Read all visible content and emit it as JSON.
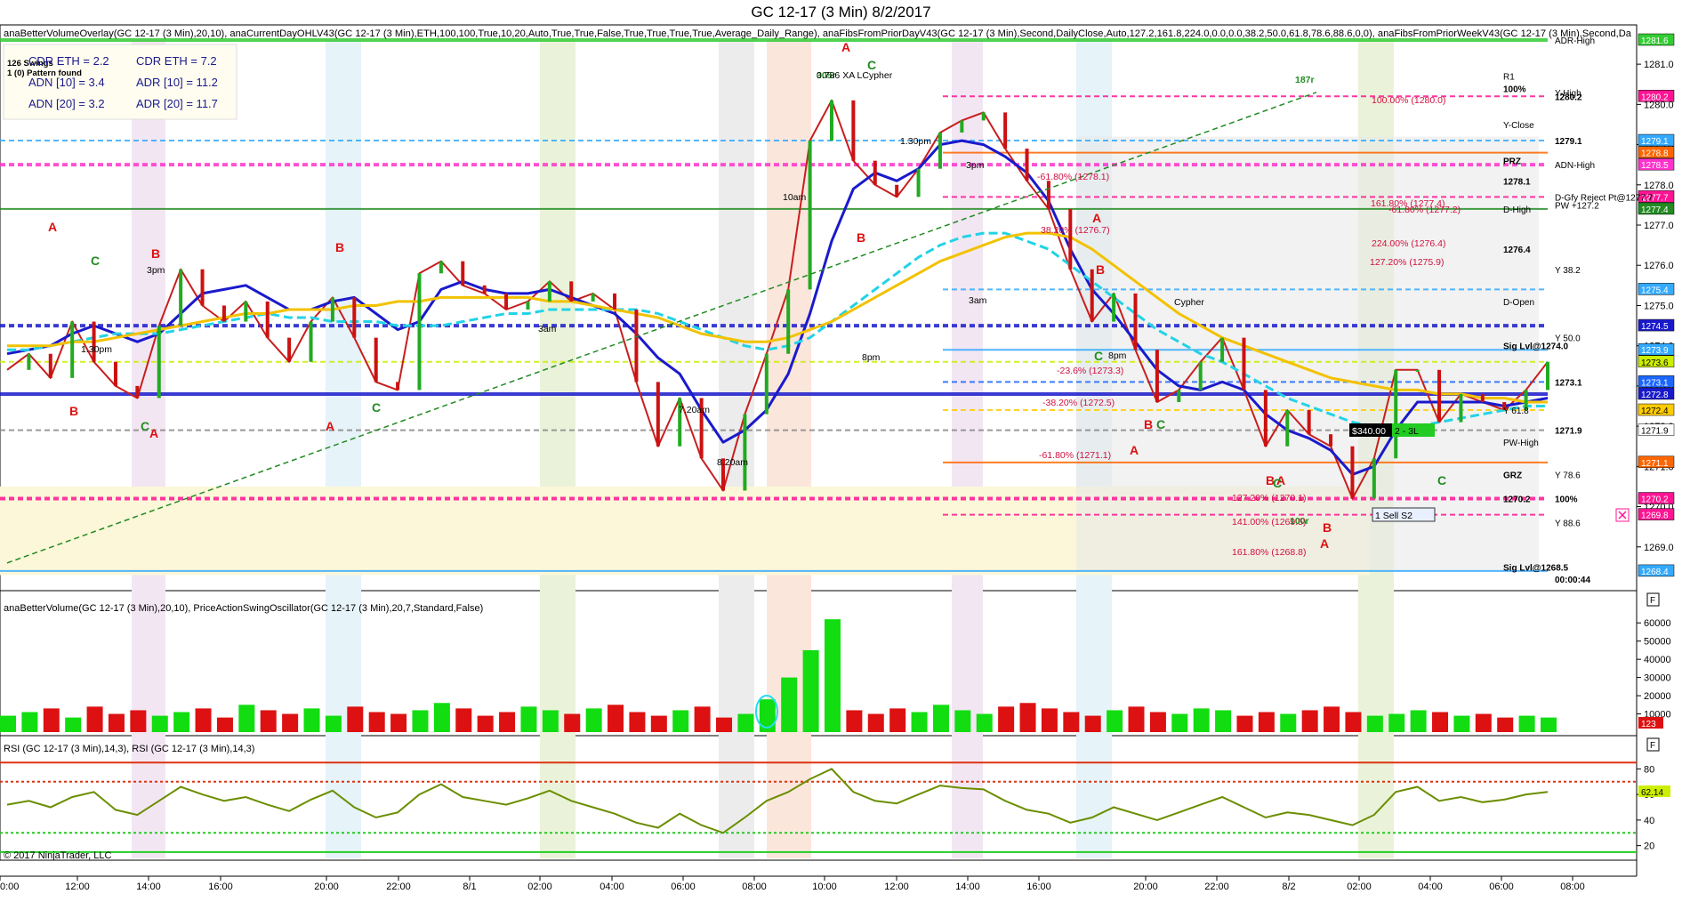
{
  "window": {
    "title": "GC 12-17 (3 Min)  8/2/2017"
  },
  "panels": {
    "price_header": "anaBetterVolumeOverlay(GC 12-17 (3 Min),20,10), anaCurrentDayOHLV43(GC 12-17 (3 Min),ETH,100,100,True,10,20,Auto,True,True,False,True,True,True,True,Average_Daily_Range), anaFibsFromPriorDayV43(GC 12-17 (3 Min),Second,DailyClose,Auto,127.2,161.8,224.0,0.0,0.0,38.2,50.0,61.8,78.6,88.6,0,0), anaFibsFromPriorWeekV43(GC 12-17 (3 Min),Second,Da",
    "volume_header": "anaBetterVolume(GC 12-17 (3 Min),20,10), PriceActionSwingOscillator(GC 12-17 (3 Min),20,7,Standard,False)",
    "rsi_header": "RSI (GC 12-17 (3 Min),14,3), RSI (GC 12-17 (3 Min),14,3)",
    "copyright": "© 2017 NinjaTrader, LLC"
  },
  "swings": {
    "count": "126 Swings",
    "pattern": "1 (0) Pattern found"
  },
  "stats_box": {
    "cdr_eth_1": "CDR ETH = 2.2",
    "cdr_eth_2": "CDR ETH = 7.2",
    "adn10_1": "ADN [10] = 3.4",
    "adr10_2": "ADR [10] = 11.2",
    "adn20_1": "ADN [20] = 3.2",
    "adr20_2": "ADR [20] = 11.7"
  },
  "axis_icons": {
    "f1": "F",
    "f2": "F"
  },
  "chart_data": [
    {
      "type": "line",
      "panel": "price",
      "x_ticks": [
        "0:00",
        "12:00",
        "14:00",
        "16:00",
        "20:00",
        "22:00",
        "8/1",
        "02:00",
        "04:00",
        "06:00",
        "08:00",
        "10:00",
        "12:00",
        "14:00",
        "16:00",
        "20:00",
        "22:00",
        "8/2",
        "02:00",
        "04:00",
        "06:00",
        "08:00"
      ],
      "y_ticks": [
        "1281.0",
        "1280.0",
        "1279.0",
        "1278.0",
        "1277.0",
        "1276.0",
        "1275.0",
        "1274.0",
        "1273.0",
        "1272.0",
        "1271.0",
        "1270.0",
        "1269.0"
      ],
      "ylim": [
        1268.0,
        1281.6
      ],
      "price_tags": [
        {
          "text": "1281.6",
          "color": "#33cc33",
          "y": 1281.6
        },
        {
          "text": "1280.2",
          "color": "#ff1493",
          "y": 1280.2
        },
        {
          "text": "1279.1",
          "color": "#33aaff",
          "y": 1279.1
        },
        {
          "text": "1278.8",
          "color": "#ff6600",
          "y": 1278.8
        },
        {
          "text": "1278.5",
          "color": "#ff33cc",
          "y": 1278.5
        },
        {
          "text": "1277.7",
          "color": "#ff1493",
          "y": 1277.7
        },
        {
          "text": "1277.4",
          "color": "#228b22",
          "y": 1277.4
        },
        {
          "text": "1275.4",
          "color": "#33aaff",
          "y": 1275.4
        },
        {
          "text": "1274.5",
          "color": "#1a1acc",
          "y": 1274.5
        },
        {
          "text": "1273.9",
          "color": "#33aaff",
          "y": 1273.9
        },
        {
          "text": "1273.6",
          "color": "#ccee00",
          "y": 1273.6
        },
        {
          "text": "1273.1",
          "color": "#1a66ff",
          "y": 1273.1
        },
        {
          "text": "1272.8",
          "color": "#1a1acc",
          "y": 1272.8
        },
        {
          "text": "1272.4",
          "color": "#ffcc00",
          "y": 1272.4
        },
        {
          "text": "1271.9",
          "color": "#ffffff",
          "y": 1271.9
        },
        {
          "text": "1271.1",
          "color": "#ff6600",
          "y": 1271.1
        },
        {
          "text": "1270.2",
          "color": "#ff1493",
          "y": 1270.2
        },
        {
          "text": "1269.8",
          "color": "#ff1493",
          "y": 1269.8
        },
        {
          "text": "1268.4",
          "color": "#33aaff",
          "y": 1268.4
        }
      ],
      "level_labels": [
        {
          "text": "ADR-High",
          "y": 1281.6
        },
        {
          "text": "R1",
          "y": 1280.7
        },
        {
          "text": "Y-High",
          "y": 1280.3
        },
        {
          "text": "100%",
          "y": 1280.4
        },
        {
          "text": "1280.2",
          "y": 1280.2
        },
        {
          "text": "Y-Close",
          "y": 1279.5
        },
        {
          "text": "1279.1",
          "y": 1279.1
        },
        {
          "text": "PRZ",
          "y": 1278.6
        },
        {
          "text": "ADN-High",
          "y": 1278.5
        },
        {
          "text": "1278.1",
          "y": 1278.1
        },
        {
          "text": "D-Gfy Reject Pt@1277.7",
          "y": 1277.7
        },
        {
          "text": "D-High",
          "y": 1277.4
        },
        {
          "text": "PW +127.2",
          "y": 1277.5
        },
        {
          "text": "1276.4",
          "y": 1276.4
        },
        {
          "text": "Y 38.2",
          "y": 1275.9
        },
        {
          "text": "D-Open",
          "y": 1275.1
        },
        {
          "text": "Y 50.0",
          "y": 1274.2
        },
        {
          "text": "Sig Lvl@1274.0",
          "y": 1274.0
        },
        {
          "text": "1273.1",
          "y": 1273.1
        },
        {
          "text": "Y 61.8",
          "y": 1272.4
        },
        {
          "text": "1271.9",
          "y": 1271.9
        },
        {
          "text": "PW-High",
          "y": 1271.6
        },
        {
          "text": "Y 78.6",
          "y": 1270.8
        },
        {
          "text": "GRZ",
          "y": 1270.8
        },
        {
          "text": "100%",
          "y": 1270.2
        },
        {
          "text": "1270.2",
          "y": 1270.2
        },
        {
          "text": "Y 88.6",
          "y": 1269.6
        },
        {
          "text": "Sig Lvl@1268.5",
          "y": 1268.5
        },
        {
          "text": "00:00:44",
          "y": 1268.2
        }
      ],
      "chart_annotations": [
        "305r",
        "187r",
        "100r",
        "1.30pm",
        "10am",
        "3pm",
        "8pm",
        "3am",
        "7.20am",
        "8.20am",
        "1.30pm",
        "3pm",
        "8pm",
        "3am",
        "Cypher",
        "-61.80% (1278.1)",
        "38.20% (1276.7)",
        "-23.6% (1273.3)",
        "-38.20% (1272.5)",
        "-61.80% (1271.1)",
        "127.20% (1270.1)",
        "141.00% (1269.5)",
        "161.80% (1268.8)",
        "-61.80% (1277.2)",
        "224.00% (1276.4)",
        "127.20% (1275.9)",
        "161.80% (1277.4)",
        "100.00% (1280.0)",
        "$340.00",
        "2 - 3L",
        "1 Sell S2",
        "0.786 XA LCypher"
      ],
      "wave_labels": [
        "A",
        "B",
        "C",
        "A",
        "B",
        "C",
        "A",
        "B",
        "C",
        "A",
        "B",
        "C",
        "A",
        "B",
        "C",
        "A",
        "B",
        "C",
        "A",
        "B",
        "C",
        "A",
        "B",
        "C"
      ],
      "series": [
        {
          "name": "Close",
          "color": "#c81e1e",
          "values": [
            1273.4,
            1273.8,
            1273.2,
            1274.6,
            1273.6,
            1273.0,
            1272.7,
            1274.5,
            1275.9,
            1275.0,
            1274.6,
            1275.1,
            1274.2,
            1273.6,
            1274.6,
            1275.2,
            1274.2,
            1273.1,
            1272.9,
            1275.8,
            1276.1,
            1275.5,
            1275.3,
            1274.9,
            1275.1,
            1275.6,
            1275.1,
            1275.3,
            1274.9,
            1273.1,
            1271.5,
            1272.7,
            1271.2,
            1270.4,
            1272.3,
            1273.8,
            1275.4,
            1279.1,
            1280.1,
            1278.6,
            1278.0,
            1277.7,
            1278.4,
            1279.3,
            1279.6,
            1279.8,
            1278.9,
            1278.1,
            1277.4,
            1275.9,
            1274.6,
            1275.3,
            1273.9,
            1272.6,
            1272.9,
            1273.6,
            1274.2,
            1272.9,
            1271.5,
            1272.4,
            1271.8,
            1271.5,
            1270.2,
            1271.2,
            1273.4,
            1273.4,
            1272.1,
            1272.8,
            1272.6,
            1272.4,
            1272.9,
            1273.6
          ]
        },
        {
          "name": "Blue MA",
          "color": "#1a1acc",
          "values": [
            1273.8,
            1273.9,
            1274.0,
            1274.3,
            1274.5,
            1274.3,
            1274.1,
            1274.3,
            1274.8,
            1275.3,
            1275.4,
            1275.5,
            1275.2,
            1274.9,
            1274.9,
            1275.1,
            1275.2,
            1274.8,
            1274.4,
            1274.6,
            1275.4,
            1275.6,
            1275.4,
            1275.3,
            1275.3,
            1275.4,
            1275.2,
            1275.0,
            1274.8,
            1274.3,
            1273.7,
            1273.3,
            1272.4,
            1271.6,
            1271.9,
            1272.4,
            1273.3,
            1274.8,
            1276.6,
            1277.9,
            1278.3,
            1278.1,
            1278.4,
            1279.0,
            1279.1,
            1279.0,
            1278.7,
            1278.3,
            1277.6,
            1276.4,
            1275.4,
            1274.8,
            1274.1,
            1273.4,
            1273.0,
            1272.9,
            1273.1,
            1272.9,
            1272.3,
            1271.9,
            1271.7,
            1271.4,
            1270.8,
            1271.0,
            1271.9,
            1272.6,
            1272.6,
            1272.6,
            1272.6,
            1272.5,
            1272.6,
            1272.7
          ]
        },
        {
          "name": "Cyan MA",
          "color": "#22d3e6",
          "values": [
            1273.9,
            1273.9,
            1274.0,
            1274.1,
            1274.2,
            1274.3,
            1274.3,
            1274.3,
            1274.4,
            1274.5,
            1274.6,
            1274.7,
            1274.8,
            1274.7,
            1274.7,
            1274.6,
            1274.6,
            1274.6,
            1274.5,
            1274.5,
            1274.5,
            1274.6,
            1274.7,
            1274.8,
            1274.8,
            1274.9,
            1274.9,
            1274.9,
            1274.9,
            1274.9,
            1274.8,
            1274.6,
            1274.4,
            1274.2,
            1274.0,
            1273.9,
            1274.0,
            1274.2,
            1274.6,
            1275.0,
            1275.4,
            1275.8,
            1276.2,
            1276.5,
            1276.7,
            1276.8,
            1276.8,
            1276.6,
            1276.4,
            1276.0,
            1275.6,
            1275.2,
            1274.8,
            1274.4,
            1274.1,
            1273.8,
            1273.6,
            1273.3,
            1273.0,
            1272.7,
            1272.5,
            1272.3,
            1272.1,
            1272.0,
            1272.0,
            1272.0,
            1272.1,
            1272.2,
            1272.3,
            1272.4,
            1272.5,
            1272.5
          ]
        },
        {
          "name": "Yellow MA",
          "color": "#f2c200",
          "values": [
            1274.0,
            1274.0,
            1274.0,
            1274.1,
            1274.1,
            1274.2,
            1274.3,
            1274.4,
            1274.5,
            1274.6,
            1274.7,
            1274.8,
            1274.8,
            1274.9,
            1274.9,
            1274.9,
            1275.0,
            1275.0,
            1275.1,
            1275.1,
            1275.2,
            1275.2,
            1275.2,
            1275.2,
            1275.2,
            1275.1,
            1275.1,
            1275.0,
            1274.9,
            1274.8,
            1274.7,
            1274.5,
            1274.3,
            1274.2,
            1274.1,
            1274.1,
            1274.2,
            1274.4,
            1274.6,
            1274.9,
            1275.2,
            1275.5,
            1275.8,
            1276.1,
            1276.3,
            1276.5,
            1276.7,
            1276.8,
            1276.8,
            1276.7,
            1276.4,
            1276.0,
            1275.6,
            1275.2,
            1274.8,
            1274.5,
            1274.2,
            1274.0,
            1273.8,
            1273.6,
            1273.4,
            1273.2,
            1273.1,
            1273.0,
            1272.9,
            1272.9,
            1272.8,
            1272.8,
            1272.7,
            1272.7,
            1272.6,
            1272.6
          ]
        }
      ]
    },
    {
      "type": "bar",
      "panel": "volume",
      "y_ticks": [
        "60000",
        "50000",
        "40000",
        "30000",
        "20000",
        "10000"
      ],
      "ylim": [
        0,
        65000
      ],
      "last_value": "123",
      "series": [
        {
          "name": "Volume",
          "values": [
            9000,
            11000,
            13000,
            8000,
            14000,
            10000,
            12000,
            9000,
            11000,
            13000,
            8000,
            15000,
            12000,
            10000,
            13000,
            9000,
            14000,
            11000,
            10000,
            12000,
            16000,
            13000,
            9000,
            11000,
            14000,
            12000,
            10000,
            13000,
            15000,
            11000,
            9000,
            12000,
            14000,
            8000,
            10000,
            18000,
            30000,
            45000,
            62000,
            12000,
            10000,
            13000,
            11000,
            15000,
            12000,
            10000,
            14000,
            16000,
            13000,
            11000,
            9000,
            12000,
            14000,
            11000,
            10000,
            13000,
            12000,
            9000,
            11000,
            10000,
            12000,
            14000,
            11000,
            9000,
            10000,
            12000,
            11000,
            9000,
            10000,
            8000,
            9000,
            8000
          ]
        }
      ]
    },
    {
      "type": "line",
      "panel": "rsi",
      "y_ticks": [
        "80",
        "60",
        "40",
        "20"
      ],
      "ylim": [
        10,
        90
      ],
      "last_value": "62.14",
      "series": [
        {
          "name": "RSI",
          "values": [
            52,
            55,
            50,
            58,
            62,
            48,
            44,
            55,
            66,
            60,
            55,
            58,
            52,
            47,
            56,
            63,
            50,
            42,
            46,
            60,
            68,
            58,
            55,
            52,
            57,
            63,
            55,
            50,
            45,
            38,
            34,
            45,
            36,
            30,
            42,
            55,
            62,
            72,
            80,
            62,
            55,
            53,
            60,
            67,
            65,
            64,
            55,
            48,
            45,
            38,
            42,
            50,
            45,
            40,
            46,
            52,
            58,
            50,
            42,
            46,
            44,
            40,
            36,
            44,
            62,
            66,
            55,
            58,
            54,
            56,
            60,
            62
          ]
        }
      ]
    }
  ]
}
